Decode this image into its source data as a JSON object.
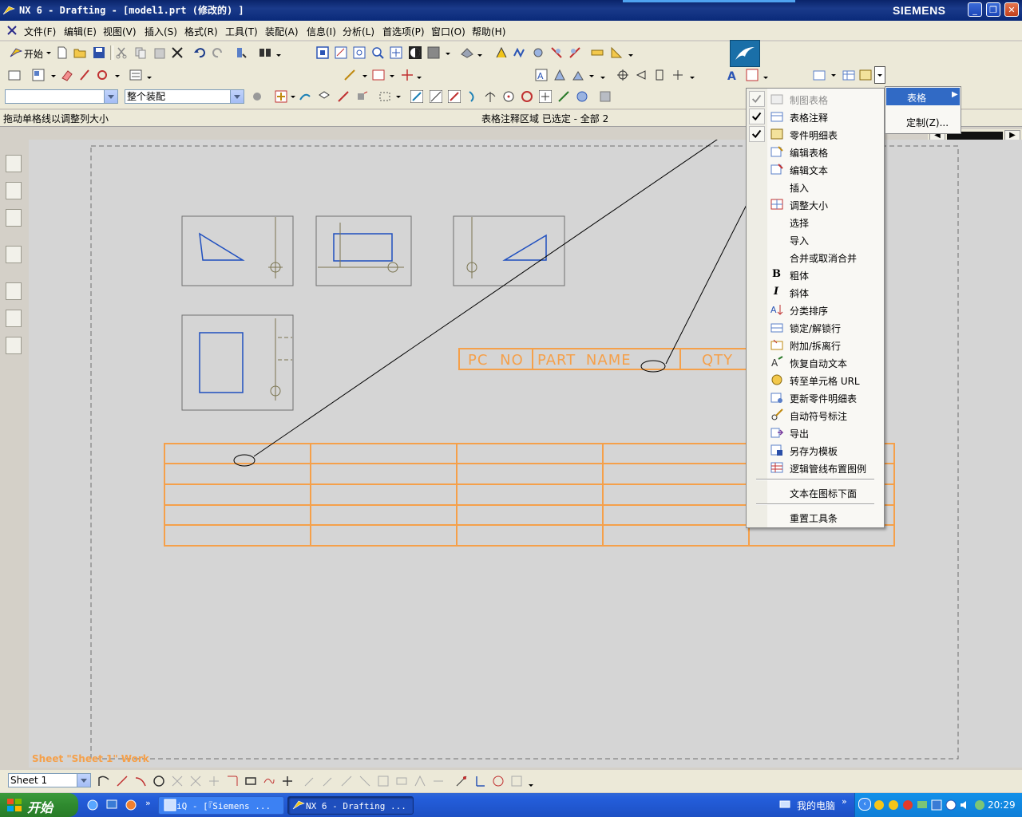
{
  "window": {
    "title": "NX 6 - Drafting - [model1.prt (修改的) ]",
    "brand": "SIEMENS",
    "min_btn": "_",
    "max_btn": "❐",
    "close_btn": "✕"
  },
  "menubar": {
    "items": [
      "文件(F)",
      "编辑(E)",
      "视图(V)",
      "插入(S)",
      "格式(R)",
      "工具(T)",
      "装配(A)",
      "信息(I)",
      "分析(L)",
      "首选项(P)",
      "窗口(O)",
      "帮助(H)"
    ]
  },
  "toolbar": {
    "start_label": "开始",
    "selection_filter_value": "",
    "assembly_scope_value": "整个装配"
  },
  "status": {
    "prompt": "拖动单格线以调整列大小",
    "selection": "表格注释区域 已选定 - 全部 2"
  },
  "drawing": {
    "sheet_label": "Sheet \"Sheet 1\" Work",
    "parts_list_headers": [
      "PC NO",
      "PART NAME",
      "QTY"
    ],
    "sheet_selector_value": "Sheet 1"
  },
  "context_menu": {
    "items": [
      {
        "label": "制图表格",
        "checked": true,
        "disabled": true,
        "icon": "drafting-table-icon"
      },
      {
        "label": "表格注释",
        "checked": true,
        "disabled": false,
        "icon": "tabular-note-icon"
      },
      {
        "label": "零件明细表",
        "checked": true,
        "disabled": false,
        "icon": "parts-list-icon"
      },
      {
        "label": "编辑表格",
        "icon": "edit-table-icon"
      },
      {
        "label": "编辑文本",
        "icon": "edit-text-icon"
      },
      {
        "label": "插入",
        "icon": ""
      },
      {
        "label": "调整大小",
        "icon": "resize-icon"
      },
      {
        "label": "选择",
        "icon": ""
      },
      {
        "label": "导入",
        "icon": ""
      },
      {
        "label": "合并或取消合并",
        "icon": ""
      },
      {
        "label": "粗体",
        "icon": "bold-icon"
      },
      {
        "label": "斜体",
        "icon": "italic-icon"
      },
      {
        "label": "分类排序",
        "icon": "sort-icon"
      },
      {
        "label": "锁定/解锁行",
        "icon": "lock-row-icon"
      },
      {
        "label": "附加/拆离行",
        "icon": "attach-row-icon"
      },
      {
        "label": "恢复自动文本",
        "icon": "restore-text-icon"
      },
      {
        "label": "转至单元格 URL",
        "icon": "url-icon"
      },
      {
        "label": "更新零件明细表",
        "icon": "update-parts-list-icon"
      },
      {
        "label": "自动符号标注",
        "icon": "auto-balloon-icon"
      },
      {
        "label": "导出",
        "icon": "export-icon"
      },
      {
        "label": "另存为模板",
        "icon": "save-template-icon"
      },
      {
        "label": "逻辑管线布置图例",
        "icon": "legend-icon"
      }
    ],
    "text_below_icon": "文本在图标下面",
    "reset_toolbar": "重置工具条"
  },
  "submenu": {
    "selected": "表格",
    "customize": "定制(Z)..."
  },
  "taskbar": {
    "start_label": "开始",
    "tasks": [
      "iQ - [『Siemens ...",
      "NX 6 - Drafting ..."
    ],
    "my_computer": "我的电脑",
    "clock": "20:29"
  },
  "colors": {
    "title_blue": "#0a246a",
    "table_orange": "#f5a04a",
    "view_border": "#6e6e6e",
    "geometry_blue": "#1f4fbf",
    "geometry_olive": "#7a7450",
    "menu_highlight": "#316ac5"
  }
}
